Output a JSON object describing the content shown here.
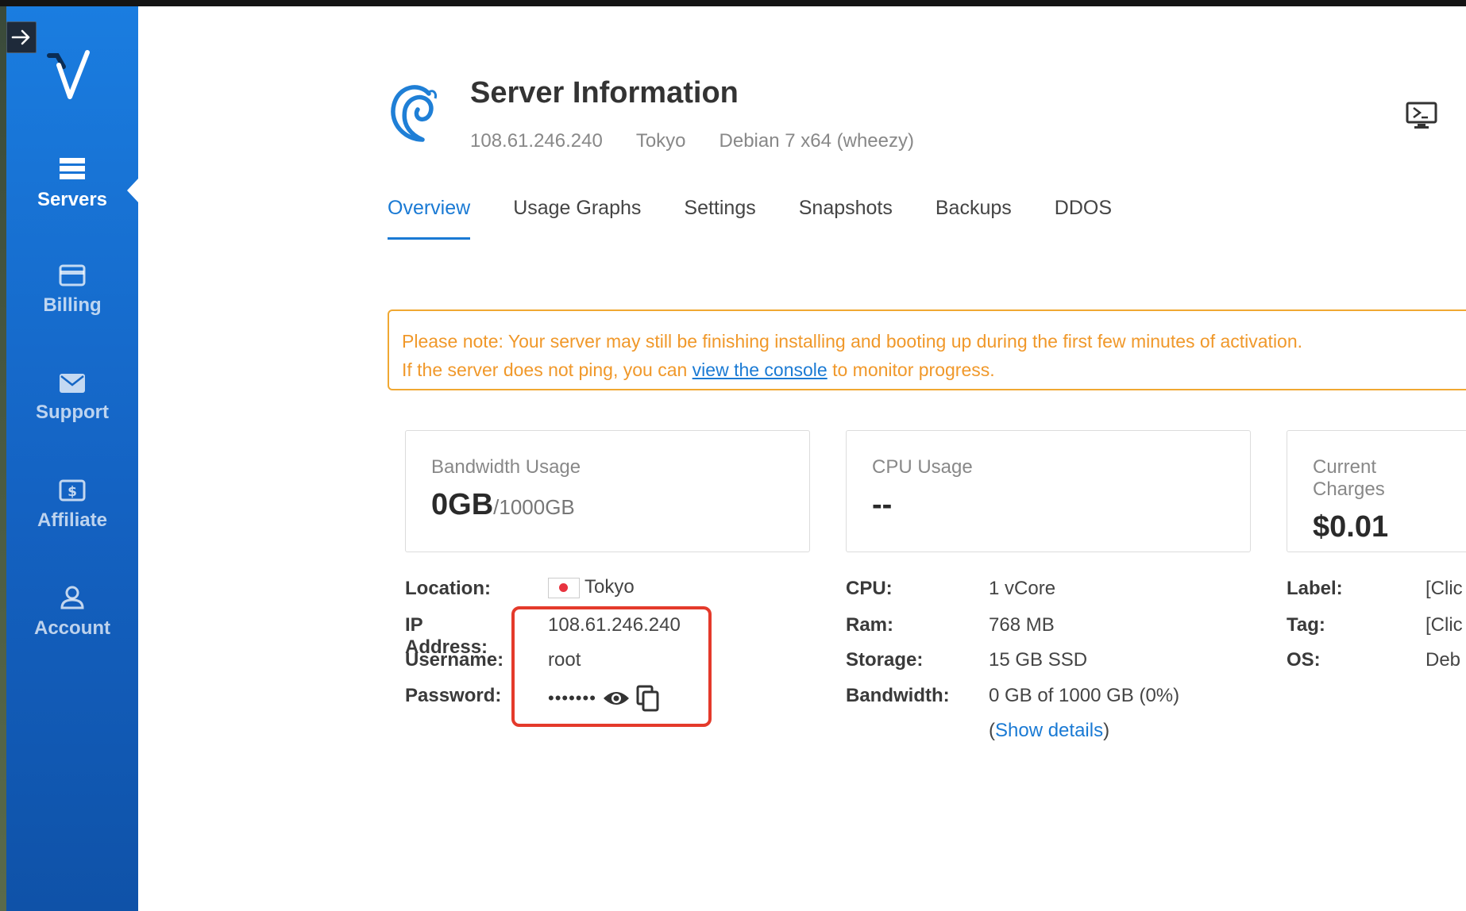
{
  "sidebar": {
    "items": [
      {
        "label": "Servers",
        "icon": "servers-icon",
        "active": true
      },
      {
        "label": "Billing",
        "icon": "billing-icon"
      },
      {
        "label": "Support",
        "icon": "support-icon"
      },
      {
        "label": "Affiliate",
        "icon": "affiliate-icon"
      },
      {
        "label": "Account",
        "icon": "account-icon"
      }
    ]
  },
  "header": {
    "title": "Server Information",
    "ip": "108.61.246.240",
    "location": "Tokyo",
    "os": "Debian 7 x64 (wheezy)"
  },
  "tabs": [
    {
      "label": "Overview",
      "active": true
    },
    {
      "label": "Usage Graphs"
    },
    {
      "label": "Settings"
    },
    {
      "label": "Snapshots"
    },
    {
      "label": "Backups"
    },
    {
      "label": "DDOS"
    }
  ],
  "notice": {
    "line1": "Please note: Your server may still be finishing installing and booting up during the first few minutes of activation.",
    "line2_before": "If the server does not ping, you can ",
    "line2_link": "view the console",
    "line2_after": " to monitor progress."
  },
  "cards": {
    "bandwidth": {
      "label": "Bandwidth Usage",
      "value": "0GB",
      "unit": "/1000GB"
    },
    "cpu": {
      "label": "CPU Usage",
      "value": "--"
    },
    "charges": {
      "label": "Current Charges",
      "value": "$0.01"
    }
  },
  "details_left": {
    "location_label": "Location:",
    "location_value": "Tokyo",
    "ip_label": "IP Address:",
    "ip_value": "108.61.246.240",
    "username_label": "Username:",
    "username_value": "root",
    "password_label": "Password:",
    "password_value": "•••••••"
  },
  "details_mid": {
    "cpu_label": "CPU:",
    "cpu_value": "1 vCore",
    "ram_label": "Ram:",
    "ram_value": "768 MB",
    "storage_label": "Storage:",
    "storage_value": "15 GB SSD",
    "bandwidth_label": "Bandwidth:",
    "bandwidth_value": "0 GB of 1000 GB (0%)",
    "show_open": "(",
    "show_details": "Show details",
    "show_close": ")"
  },
  "details_right": {
    "label_label": "Label:",
    "label_value": "[Clic",
    "tag_label": "Tag:",
    "tag_value": "[Clic",
    "os_label": "OS:",
    "os_value": "Deb"
  },
  "colors": {
    "sidebar": "#1a7de0",
    "accent": "#1a7ad4",
    "notice": "#f0a832",
    "highlight": "#e43a2b"
  }
}
